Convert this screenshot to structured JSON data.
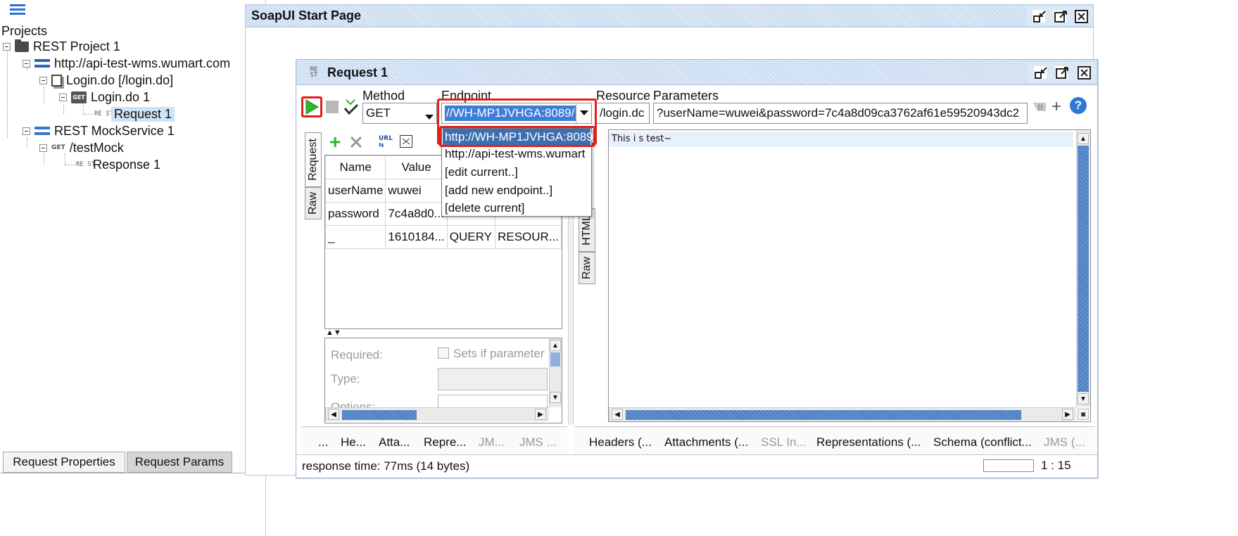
{
  "navigator": {
    "section_label": "Projects",
    "tree": [
      {
        "label": "REST Project 1"
      },
      {
        "label": "http://api-test-wms.wumart.com"
      },
      {
        "label": "Login.do [/login.do]"
      },
      {
        "label": "Login.do 1",
        "badge": "GET"
      },
      {
        "label": "Request 1",
        "badge": "RE ST",
        "selected": true
      },
      {
        "label": "REST MockService 1"
      },
      {
        "label": "/testMock",
        "badge": "GET"
      },
      {
        "label": "Response 1",
        "badge": "RE ST"
      }
    ],
    "bottom_tabs": [
      "Request Properties",
      "Request Params"
    ]
  },
  "start_page": {
    "title": "SoapUI Start Page"
  },
  "request_window": {
    "badge": "RE ST",
    "title": "Request 1",
    "labels": {
      "method": "Method",
      "endpoint": "Endpoint",
      "resource": "Resource",
      "parameters": "Parameters"
    },
    "method_value": "GET",
    "endpoint_value": "//WH-MP1JVHGA:8089/",
    "resource_value": "/login.dc",
    "parameters_value": "?userName=wuwei&password=7c4a8d09ca3762af61e59520943dc2",
    "endpoint_options": [
      "http://WH-MP1JVHGA:8089",
      "http://api-test-wms.wumart",
      "[edit current..]",
      "[add new endpoint..]",
      "[delete current]"
    ],
    "request_side_tabs": [
      "Request",
      "Raw"
    ],
    "param_table": {
      "headers": [
        "Name",
        "Value",
        "",
        ""
      ],
      "rows": [
        [
          "userName",
          "wuwei",
          "",
          ""
        ],
        [
          "password",
          "7c4a8d0...",
          "",
          ""
        ],
        [
          "_",
          "1610184...",
          "QUERY",
          "RESOUR..."
        ]
      ]
    },
    "param_detail": {
      "required": "Required:",
      "sets_if": "Sets if parameter",
      "type": "Type:",
      "options": "Options:"
    },
    "request_bottom_tabs": [
      "...",
      "He...",
      "Atta...",
      "Repre...",
      "JM...",
      "JMS ..."
    ],
    "response_side_tabs": [
      "HTML",
      "Raw"
    ],
    "response_text": "This i s test~",
    "response_bottom_tabs": [
      "Headers (...",
      "Attachments (...",
      "SSL In...",
      "Representations (...",
      "Schema (conflict...",
      "JMS (..."
    ],
    "status_text": "response time: 77ms (14 bytes)",
    "cursor_pos": "1 : 15"
  },
  "colors": {
    "accent_red": "#e0201c",
    "run_green": "#2fb52f",
    "selection_blue": "#3d7ed8",
    "title_bar": "#dbe8f7"
  }
}
